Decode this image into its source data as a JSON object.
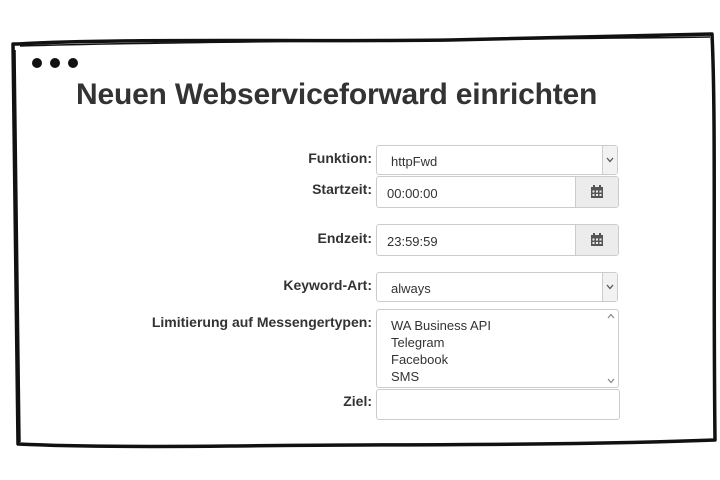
{
  "page": {
    "title": "Neuen Webserviceforward einrichten"
  },
  "form": {
    "funktion": {
      "label": "Funktion:",
      "value": "httpFwd"
    },
    "startzeit": {
      "label": "Startzeit:",
      "value": "00:00:00"
    },
    "endzeit": {
      "label": "Endzeit:",
      "value": "23:59:59"
    },
    "keyword_art": {
      "label": "Keyword-Art:",
      "value": "always"
    },
    "messengertypen": {
      "label": "Limitierung auf Messengertypen:",
      "options": [
        "WA Business API",
        "Telegram",
        "Facebook",
        "SMS"
      ]
    },
    "ziel": {
      "label": "Ziel:",
      "value": ""
    }
  },
  "icons": {
    "calendar": "calendar-icon",
    "dropdown": "chevron-down-icon",
    "scroll_up": "scroll-up-icon",
    "scroll_down": "scroll-down-icon"
  },
  "colors": {
    "text": "#333333",
    "border": "#cccccc",
    "addon_bg": "#ececec",
    "frame": "#111111"
  }
}
